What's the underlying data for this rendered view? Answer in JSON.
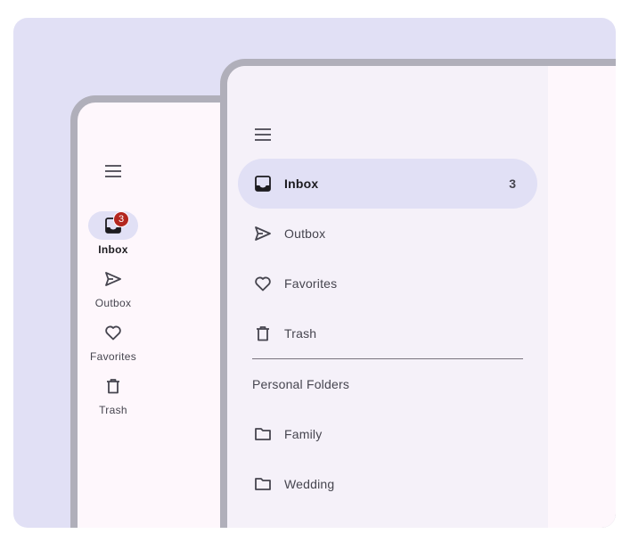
{
  "rail": {
    "menu_icon": "menu-icon",
    "items": [
      {
        "label": "Inbox",
        "icon": "inbox-icon",
        "badge": "3",
        "active": true
      },
      {
        "label": "Outbox",
        "icon": "send-icon",
        "active": false
      },
      {
        "label": "Favorites",
        "icon": "heart-icon",
        "active": false
      },
      {
        "label": "Trash",
        "icon": "trash-icon",
        "active": false
      }
    ]
  },
  "drawer": {
    "menu_icon": "menu-icon",
    "items": [
      {
        "label": "Inbox",
        "icon": "inbox-icon",
        "count": "3",
        "active": true
      },
      {
        "label": "Outbox",
        "icon": "send-icon",
        "active": false
      },
      {
        "label": "Favorites",
        "icon": "heart-icon",
        "active": false
      },
      {
        "label": "Trash",
        "icon": "trash-icon",
        "active": false
      }
    ],
    "section_title": "Personal Folders",
    "folders": [
      {
        "label": "Family",
        "icon": "folder-icon"
      },
      {
        "label": "Wedding",
        "icon": "folder-icon"
      }
    ]
  },
  "colors": {
    "stage_background": "#e1e0f5",
    "surface": "#fef7fc",
    "drawer_surface": "#f5f1f9",
    "active_indicator": "#e1e0f5",
    "badge": "#b3261e",
    "frame": "#b0afba"
  }
}
